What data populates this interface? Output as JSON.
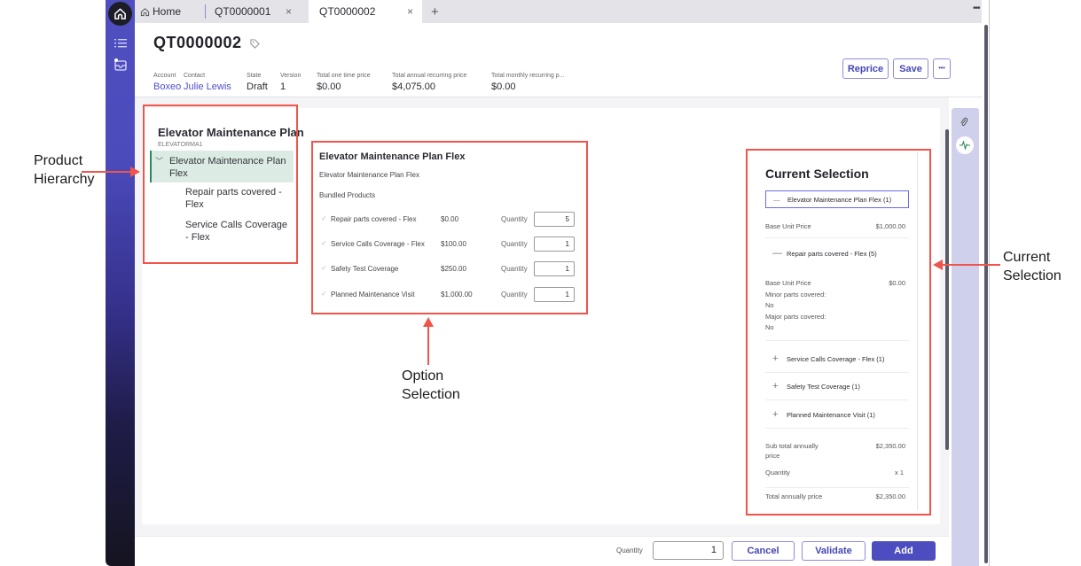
{
  "tabs": {
    "home": "Home",
    "items": [
      {
        "label": "QT0000001"
      },
      {
        "label": "QT0000002"
      }
    ],
    "close_glyph": "×",
    "new_tab_glyph": "+",
    "more_glyph": "•••"
  },
  "rail": {
    "icons": [
      "home-icon",
      "list-icon",
      "inbox-icon"
    ]
  },
  "header": {
    "title": "QT0000002",
    "tag_icon": "tag-icon",
    "fields": [
      {
        "key": "Account",
        "value": "Boxeo",
        "link": true
      },
      {
        "key": "Contact",
        "value": "Julie Lewis",
        "link": true
      },
      {
        "key": "State",
        "value": "Draft",
        "link": false
      },
      {
        "key": "Version",
        "value": "1",
        "link": false
      },
      {
        "key": "Total one time price",
        "value": "$0.00",
        "link": false
      },
      {
        "key": "Total annual recurring price",
        "value": "$4,075.00",
        "link": false
      },
      {
        "key": "Total monthly recurring p...",
        "value": "$0.00",
        "link": false
      }
    ],
    "buttons": {
      "reprice": "Reprice",
      "save": "Save",
      "more": "•••"
    }
  },
  "product": {
    "title": "Elevator Maintenance Plan",
    "code": "ELEVATORMA1"
  },
  "hierarchy": {
    "root": {
      "label_line1": "Elevator Maintenance Plan",
      "label_line2": "Flex",
      "expanded": true
    },
    "children": [
      {
        "line1": "Repair parts covered -",
        "line2": "Flex"
      },
      {
        "line1": "Service Calls Coverage",
        "line2": "- Flex"
      }
    ]
  },
  "options": {
    "title": "Elevator Maintenance Plan Flex",
    "subtitle": "Elevator Maintenance Plan Flex",
    "section": "Bundled Products",
    "quantity_label": "Quantity",
    "rows": [
      {
        "name": "Repair parts covered - Flex",
        "price": "$0.00",
        "quantity": "5",
        "checked": true
      },
      {
        "name": "Service Calls Coverage - Flex",
        "price": "$100.00",
        "quantity": "1",
        "checked": true
      },
      {
        "name": "Safety Test Coverage",
        "price": "$250.00",
        "quantity": "1",
        "checked": true
      },
      {
        "name": "Planned Maintenance Visit",
        "price": "$1,000.00",
        "quantity": "1",
        "checked": true
      }
    ]
  },
  "current_selection": {
    "title": "Current Selection",
    "top_item": "Elevator Maintenance Plan Flex (1)",
    "base_unit_price_label": "Base Unit Price",
    "base_unit_price": "$1,000.00",
    "sub_item": "Repair parts covered - Flex (5)",
    "sub_base_unit_price": "$0.00",
    "minor_label": "Minor parts covered:",
    "minor_value": "No",
    "major_label": "Major parts covered:",
    "major_value": "No",
    "collapsed_items": [
      "Service Calls Coverage - Flex (1)",
      "Safety Test Coverage (1)",
      "Planned Maintenance Visit (1)"
    ],
    "subtotal_label_line1": "Sub total annually",
    "subtotal_label_line2": "price",
    "subtotal": "$2,350.00",
    "quantity_label": "Quantity",
    "quantity": "x 1",
    "total_label": "Total annually price",
    "total": "$2,350.00",
    "collapse_glyph": "—",
    "expand_glyph": "+"
  },
  "footer": {
    "quantity_label": "Quantity",
    "quantity_value": "1",
    "cancel": "Cancel",
    "validate": "Validate",
    "add": "Add"
  },
  "annotations": {
    "product_hierarchy": [
      "Product",
      "Hierarchy"
    ],
    "option_selection": [
      "Option",
      "Selection"
    ],
    "current_selection": [
      "Current",
      "Selection"
    ]
  },
  "colors": {
    "accent": "#4d4dbf",
    "annotation": "#f0544a",
    "tree_selected_bg": "#dcece4",
    "link": "#4e4ed0"
  }
}
